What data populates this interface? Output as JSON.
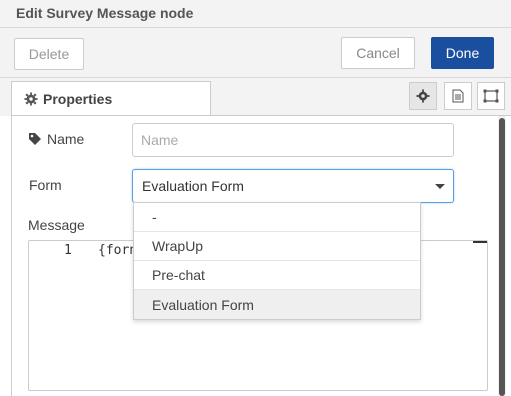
{
  "dialog": {
    "title": "Edit Survey Message node"
  },
  "toolbar": {
    "delete_label": "Delete",
    "cancel_label": "Cancel",
    "done_label": "Done"
  },
  "tabs": {
    "properties_label": "Properties",
    "icon_tabs": [
      "gear-icon",
      "document-icon",
      "frame-icon"
    ]
  },
  "fields": {
    "name_label": "Name",
    "name_placeholder": "Name",
    "name_value": "",
    "form_label": "Form",
    "form_selected": "Evaluation Form",
    "message_label": "Message"
  },
  "dropdown": {
    "options": [
      "-",
      "WrapUp",
      "Pre-chat",
      "Evaluation Form"
    ],
    "selected_index": 3
  },
  "editor": {
    "line_number": "1",
    "code_visible": "{forn"
  },
  "colors": {
    "primary": "#1a4fa0",
    "focus_border": "#5a9ee0"
  }
}
